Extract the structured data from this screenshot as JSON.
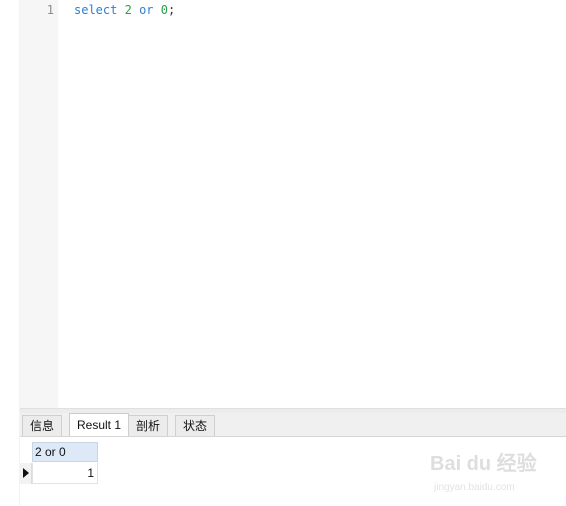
{
  "editor": {
    "line_number": "1",
    "tokens": {
      "kw_select": "select",
      "num_2": "2",
      "kw_or": "or",
      "num_0": "0",
      "semicolon": ";"
    }
  },
  "tabs": [
    {
      "label": "信息"
    },
    {
      "label": "Result 1"
    },
    {
      "label": "剖析"
    },
    {
      "label": "状态"
    }
  ],
  "result": {
    "column_header": "2 or 0",
    "row_value": "1"
  },
  "watermark": {
    "brand": "Bai du 经验",
    "url": "jingyan.baidu.com"
  },
  "colors": {
    "keyword": "#2a7fd4",
    "number": "#2aa14a",
    "header_bg": "#dde9f6"
  }
}
